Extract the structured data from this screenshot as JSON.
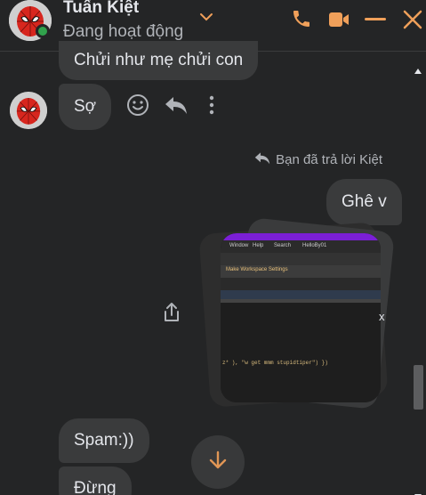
{
  "header": {
    "contact_name": "Tuấn Kiệt",
    "status": "Đang hoạt động",
    "icons": [
      "chevron-down-icon",
      "phone-icon",
      "video-camera-icon",
      "minimize-icon",
      "close-icon"
    ]
  },
  "messages": {
    "m1": "Chửi như mẹ chửi con",
    "m2": "Sợ",
    "reply_note": "Bạn đã trả lời Kiệt",
    "m3": "Ghê v",
    "m4": "Spam:))",
    "m5": "Đừng"
  },
  "screenshot_thumb": {
    "menu_items": [
      "Window",
      "Help",
      "Search",
      "HelloBy01"
    ],
    "banner": "Make Workspace Settings",
    "code_line": "z* ), \"w get mmm stupidtiper\") })",
    "stray_char": "x"
  },
  "colors": {
    "background": "#242526",
    "bubble": "#3a3b3c",
    "accent": "#f0a05a",
    "online": "#31a24c"
  }
}
